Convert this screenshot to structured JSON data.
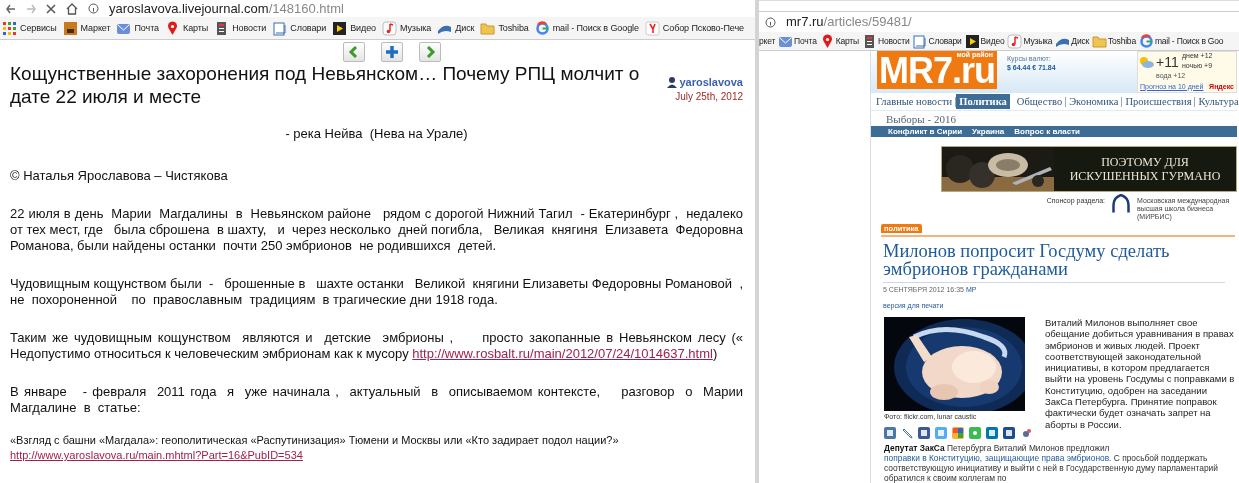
{
  "left_window": {
    "address": {
      "host": "yaroslavova.livejournal.com",
      "path": "/148160.html"
    },
    "bookmarks": [
      {
        "kind": "apps",
        "label": "Сервисы"
      },
      {
        "kind": "market",
        "label": "Маркет"
      },
      {
        "kind": "mail",
        "label": "Почта"
      },
      {
        "kind": "pin",
        "label": "Карты"
      },
      {
        "kind": "news",
        "label": "Новости"
      },
      {
        "kind": "dict",
        "label": "Словари"
      },
      {
        "kind": "video",
        "label": "Видео"
      },
      {
        "kind": "music",
        "label": "Музыка"
      },
      {
        "kind": "disk",
        "label": "Диск"
      },
      {
        "kind": "folder",
        "label": "Toshiba"
      },
      {
        "kind": "google",
        "label": "mail - Поиск в Google"
      },
      {
        "kind": "yandex",
        "label": "Собор Псково-Пече"
      }
    ],
    "post": {
      "nav": [
        {
          "kind": "prev"
        },
        {
          "kind": "add"
        },
        {
          "kind": "next"
        }
      ],
      "title": "Кощунственные захоронения под Невьянском… Почему РПЦ молчит о дате 22 июля и месте",
      "author": "yaroslavova",
      "date": "July 25th, 2012",
      "paragraphs": [
        {
          "kind": "center",
          "parts": [
            {
              "kind": "text",
              "text": "- река Нейва  (Нева на Урале)"
            }
          ]
        },
        {
          "kind": "body",
          "parts": [
            {
              "kind": "text",
              "text": "© Наталья Ярославова – Чистякова"
            }
          ]
        },
        {
          "kind": "body",
          "parts": [
            {
              "kind": "text",
              "text": "22 июля в день  Марии  Магдалины  в  Невьянском районе   рядом с дорогой Нижний Тагил  - Екатеринбург ,  недалеко от тех мест, где   была сброшена  в шахту,   и  через несколько  дней погибла,   Великая  княгиня  Елизавета  Федоровна  Романова, были найдены останки  почти 250 эмбрионов  не родившихся  детей."
            }
          ]
        },
        {
          "kind": "body",
          "parts": [
            {
              "kind": "text",
              "text": "Чудовищным кощунством были  -   брошенные в   шахте останки   Великой  княгини Елизаветы Федоровны Романовой  ,   не  похороненной    по  православным  традициям  в трагические дни 1918 года."
            }
          ]
        },
        {
          "kind": "body",
          "parts": [
            {
              "kind": "text",
              "text": "Таким же чудовищным кощунством  являются и  детские  эмбрионы ,     просто закопанные в Невьянском лесу («  Недопустимо относиться к человеческим эмбрионам как к мусору "
            },
            {
              "kind": "link",
              "text": "http://www.rosbalt.ru/main/2012/07/24/1014637.html"
            },
            {
              "kind": "text",
              "text": ")"
            }
          ]
        },
        {
          "kind": "body",
          "parts": [
            {
              "kind": "text",
              "text": "В январе   - февраля  2011 года  я  уже начинала ,  актуальный  в  описываемом контексте,    разговор  о  Марии  Магдалине  в  статье:"
            }
          ]
        },
        {
          "kind": "small",
          "parts": [
            {
              "kind": "text",
              "text": "«Взгляд с башни «Магдала»: геополитическая «Распутинизация» Тюмени и Москвы или «Кто задирает подол нации?» "
            },
            {
              "kind": "link",
              "text": "http://www.yaroslavova.ru/main.mhtml?Part=16&PubID=534"
            }
          ]
        }
      ]
    }
  },
  "right_window": {
    "address": {
      "host": "mr7.ru",
      "path": "/articles/59481/"
    },
    "bookmarks": [
      {
        "kind": "none",
        "label": "ркет"
      },
      {
        "kind": "mail",
        "label": "Почта"
      },
      {
        "kind": "pin",
        "label": "Карты"
      },
      {
        "kind": "news",
        "label": "Новости"
      },
      {
        "kind": "dict",
        "label": "Словари"
      },
      {
        "kind": "video",
        "label": "Видео"
      },
      {
        "kind": "music",
        "label": "Музыка"
      },
      {
        "kind": "disk",
        "label": "Диск"
      },
      {
        "kind": "folder",
        "label": "Toshiba"
      },
      {
        "kind": "google",
        "label": "mail - Поиск в Goo"
      }
    ],
    "site": {
      "logo": {
        "name": "MR7.ru",
        "tagline": "мой район"
      },
      "rates": {
        "label": "Курсы валют:",
        "value": "$ 64.44  € 71.84"
      },
      "weather": {
        "temp": "+11",
        "day": "днем +12",
        "night": "ночью +9",
        "water": "вода +12",
        "forecast": "Прогноз на 10 дней",
        "provider": "Яндекс"
      },
      "nav": [
        {
          "label": "Главные новости",
          "selected": false
        },
        {
          "label": "Политика",
          "selected": true
        },
        {
          "label": "Общество",
          "selected": false
        },
        {
          "label": "Экономика",
          "selected": false
        },
        {
          "label": "Происшествия",
          "selected": false
        },
        {
          "label": "Культура",
          "selected": false
        }
      ],
      "subnav": "Выборы - 2016",
      "topics": [
        "Конфликт в Сирии",
        "Украина",
        "Вопрос к власти"
      ],
      "ad": {
        "lines": [
          "ПОЭТОМУ ДЛЯ",
          "ИСКУШЕННЫХ ГУРМАНО"
        ]
      },
      "sponsor": {
        "label": "Спонсор раздела:",
        "name": "Московская международная высшая школа бизнеса (МИРБИС)"
      },
      "article": {
        "rubric": "политика",
        "title": "Милонов попросит Госдуму сделать эмбрионов гражданами",
        "date": "5 СЕНТЯБРЯ 2012 16:35",
        "author": "МР",
        "print": "версия для печати",
        "caption": "Фото: flickr.com, lunar caustic",
        "share": [
          {
            "kind": "vk"
          },
          {
            "kind": "lj"
          },
          {
            "kind": "fb"
          },
          {
            "kind": "tw"
          },
          {
            "kind": "mm"
          },
          {
            "kind": "gp"
          },
          {
            "kind": "in"
          },
          {
            "kind": "od"
          },
          {
            "kind": "other"
          }
        ],
        "lead": "Виталий Милонов выполняет свое обещание добиться уравнивания в правах эмбрионов и живых людей. Проект соответствующей законодательной инициативы, в котором предлагается выйти на уровень Госдумы с поправками в Конституцию, одобрен на заседании ЗакСа Петербурга. Принятие поправок фактически будет означать запрет на аборты в России.",
        "body": [
          {
            "kind": "bold",
            "text": "Депутат ЗакСа"
          },
          {
            "kind": "text",
            "text": " Петербурга Виталий Милонов предложил "
          },
          {
            "kind": "link",
            "text": "поправки в Конституцию,"
          },
          {
            "kind": "link",
            "text": "защищающие права эмбрионов."
          },
          {
            "kind": "text",
            "text": " С просьбой поддержать соответствующую инициативу и выйти с ней в Государственную думу парламентарий обратился к своим коллегам по"
          }
        ]
      }
    }
  }
}
